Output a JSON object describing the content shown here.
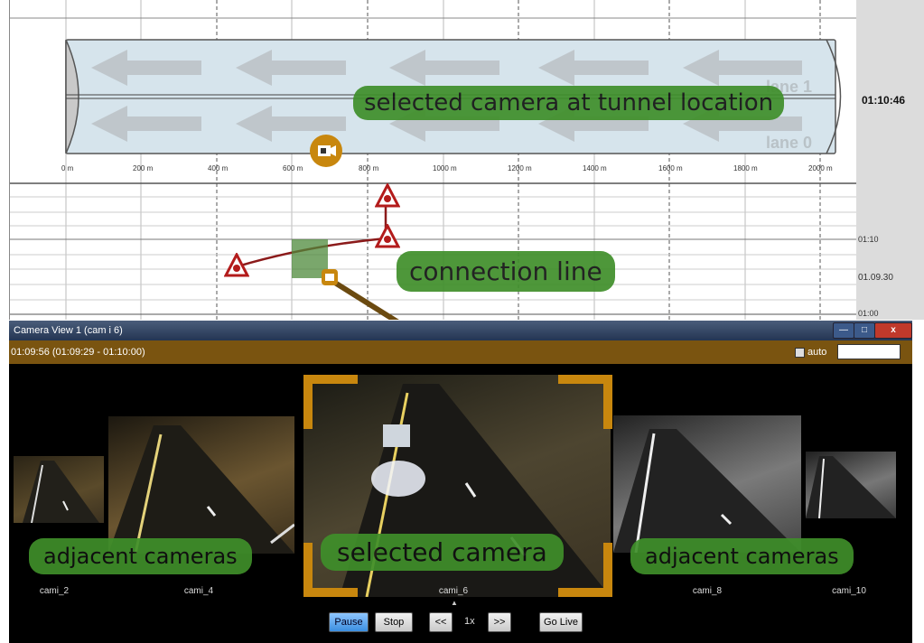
{
  "map": {
    "lane_labels": [
      "lane 1",
      "lane 0"
    ],
    "distance_ticks": [
      "0 m",
      "200 m",
      "400 m",
      "600 m",
      "800 m",
      "1000 m",
      "1200 m",
      "1400 m",
      "1600 m",
      "1800 m",
      "2000 m"
    ],
    "time_main": "01:10:46",
    "time_ticks": [
      "01:10",
      "01.09.30",
      "01:00"
    ],
    "callouts": {
      "tunnel": "selected camera at tunnel location",
      "connection": "connection line"
    }
  },
  "camera_window": {
    "title": "Camera View 1 (cam i 6)",
    "timestamp": "01:09:56 (01:09:29 - 01:10:00)",
    "auto_label": "auto",
    "camera_select": "cam_i_6",
    "cameras": [
      "cami_2",
      "cami_4",
      "cami_6",
      "cami_8",
      "cami_10"
    ],
    "callouts": {
      "adjacent_left": "adjacent cameras",
      "selected": "selected camera",
      "adjacent_right": "adjacent cameras"
    },
    "controls": {
      "pause": "Pause",
      "stop": "Stop",
      "rewind": "<<",
      "speed": "1x",
      "forward": ">>",
      "go_live": "Go Live"
    }
  },
  "colors": {
    "accent_orange": "#c8870e",
    "callout_green": "#3f8f2a",
    "incident_red": "#8b1a1a",
    "tunnel_fill": "#d6e4ec"
  }
}
